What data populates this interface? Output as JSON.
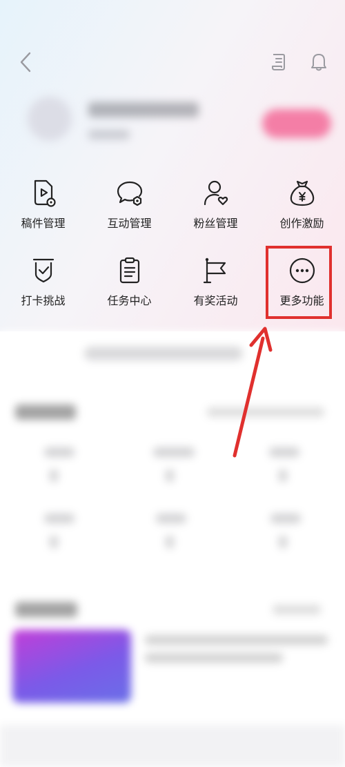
{
  "header": {
    "back_icon": "chevron-left-icon",
    "doc_icon": "document-icon",
    "bell_icon": "bell-icon"
  },
  "grid": {
    "items": [
      {
        "label": "稿件管理",
        "icon": "manuscript-icon"
      },
      {
        "label": "互动管理",
        "icon": "chat-gear-icon"
      },
      {
        "label": "粉丝管理",
        "icon": "user-heart-icon"
      },
      {
        "label": "创作激励",
        "icon": "money-bag-icon"
      },
      {
        "label": "打卡挑战",
        "icon": "shield-check-icon"
      },
      {
        "label": "任务中心",
        "icon": "clipboard-icon"
      },
      {
        "label": "有奖活动",
        "icon": "flag-icon"
      },
      {
        "label": "更多功能",
        "icon": "more-dots-icon"
      }
    ]
  },
  "annotation": {
    "highlight_color": "#e0302e",
    "highlighted_item": "更多功能"
  },
  "colors": {
    "accent_pink": "#f47ea6",
    "icon_stroke": "#222222"
  }
}
